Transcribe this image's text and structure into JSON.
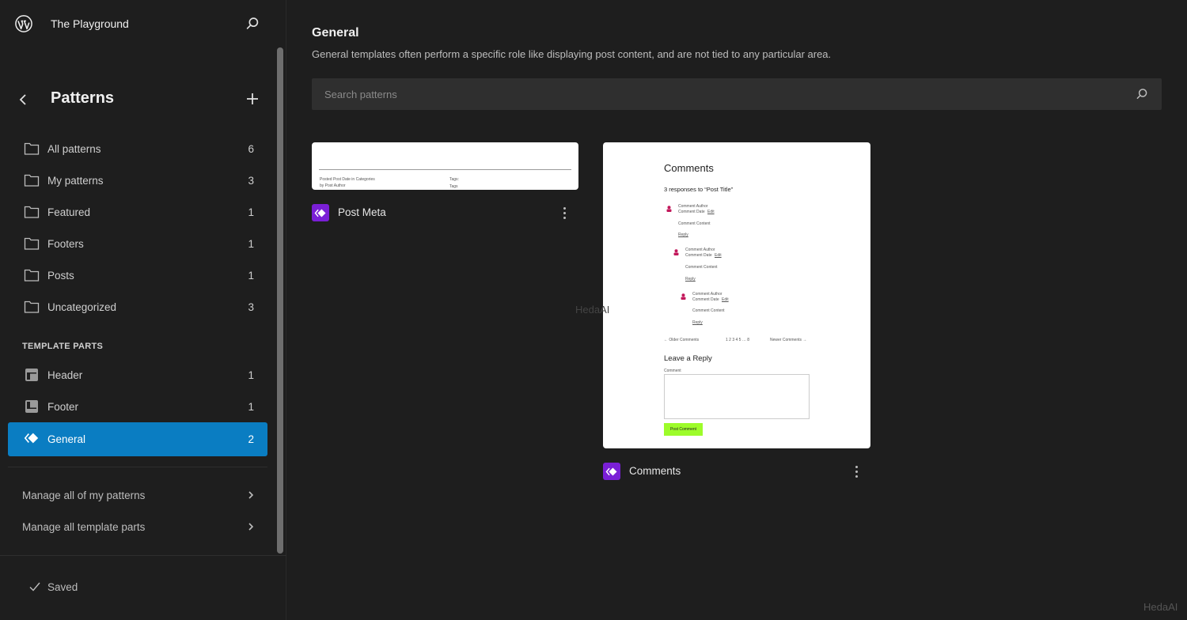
{
  "site": {
    "title": "The Playground",
    "logo_icon": "wordpress-logo",
    "search_icon": "search-icon"
  },
  "sidebar": {
    "title": "Patterns",
    "back_icon": "chevron-left-icon",
    "add_icon": "plus-icon",
    "pattern_categories": [
      {
        "label": "All patterns",
        "count": "6",
        "icon": "folder-icon"
      },
      {
        "label": "My patterns",
        "count": "3",
        "icon": "folder-icon"
      },
      {
        "label": "Featured",
        "count": "1",
        "icon": "folder-icon"
      },
      {
        "label": "Footers",
        "count": "1",
        "icon": "folder-icon"
      },
      {
        "label": "Posts",
        "count": "1",
        "icon": "folder-icon"
      },
      {
        "label": "Uncategorized",
        "count": "3",
        "icon": "folder-icon"
      }
    ],
    "template_parts_heading": "Template Parts",
    "template_parts": [
      {
        "label": "Header",
        "count": "1",
        "icon": "header-icon"
      },
      {
        "label": "Footer",
        "count": "1",
        "icon": "footer-icon"
      },
      {
        "label": "General",
        "count": "2",
        "icon": "symbol-icon",
        "active": true
      }
    ],
    "manage_links": [
      {
        "label": "Manage all of my patterns"
      },
      {
        "label": "Manage all template parts"
      }
    ],
    "status": "Saved"
  },
  "main": {
    "title": "General",
    "description": "General templates often perform a specific role like displaying post content, and are not tied to any particular area.",
    "search": {
      "placeholder": "Search patterns",
      "value": ""
    },
    "patterns": [
      {
        "title": "Post Meta",
        "preview": {
          "posted_line": "Posted  Post Date  in  Categories",
          "by_line": "by  Post Author",
          "tags_1": "Tags:",
          "tags_2": "Tags"
        }
      },
      {
        "title": "Comments",
        "preview": {
          "heading": "Comments",
          "responses": "3 responses to “Post Title”",
          "comments": [
            {
              "author": "Comment Author",
              "date": "Comment Date",
              "edit": "Edit",
              "content": "Comment Content",
              "reply": "Reply"
            },
            {
              "author": "Comment Author",
              "date": "Comment Date",
              "edit": "Edit",
              "content": "Comment Content",
              "reply": "Reply"
            },
            {
              "author": "Comment Author",
              "date": "Comment Date",
              "edit": "Edit",
              "content": "Comment Content",
              "reply": "Reply"
            }
          ],
          "older": "←  Older Comments",
          "pagination": "1 2 3 4 5 … 8",
          "newer": "Newer Comments  →",
          "reply_heading": "Leave a Reply",
          "comment_label": "Comment",
          "submit": "Post Comment"
        }
      }
    ]
  },
  "watermark": "HedaAI",
  "colors": {
    "accent": "#0a7dc2",
    "pattern_icon": "#7a1fd6",
    "post_comment_button": "#9dfc2a",
    "avatar": "#c2185b"
  }
}
